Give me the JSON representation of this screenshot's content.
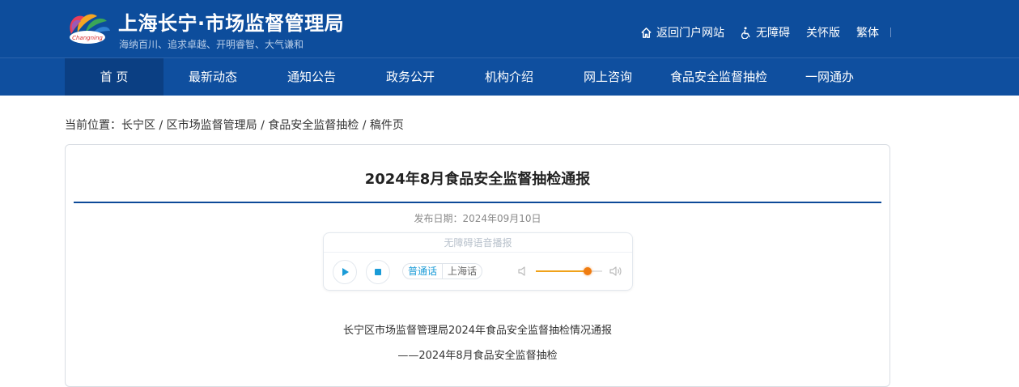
{
  "header": {
    "site_title": "上海长宁·市场监督管理局",
    "slogan": "海纳百川、追求卓越、开明睿智、大气谦和",
    "top_links": [
      {
        "label": "返回门户网站",
        "icon": "home-icon"
      },
      {
        "label": "无障碍",
        "icon": "wheelchair-icon"
      },
      {
        "label": "关怀版",
        "icon": ""
      },
      {
        "label": "繁体",
        "icon": ""
      }
    ]
  },
  "nav": {
    "items": [
      "首 页",
      "最新动态",
      "通知公告",
      "政务公开",
      "机构介绍",
      "网上咨询",
      "食品安全监督抽检",
      "一网通办"
    ],
    "active_index": 0
  },
  "breadcrumb": {
    "prefix": "当前位置：",
    "items": [
      "长宁区",
      "区市场监督管理局",
      "食品安全监督抽检",
      "稿件页"
    ],
    "separators": [
      " / ",
      " / ",
      " / "
    ]
  },
  "article": {
    "title": "2024年8月食品安全监督抽检通报",
    "publish_date": "发布日期：2024年09月10日",
    "body_lines": [
      "长宁区市场监督管理局2024年食品安全监督抽检情况通报",
      "——2024年8月食品安全监督抽检"
    ]
  },
  "player": {
    "header": "无障碍语音播报",
    "languages": [
      "普通话",
      "上海话"
    ],
    "active_language_index": 0,
    "volume": 0.78,
    "play_icon": "play-icon",
    "stop_icon": "stop-icon",
    "accent_color": "#1a9bd7",
    "volume_color": "#f07c10"
  },
  "colors": {
    "brand_blue": "#0d4a98",
    "nav_active": "#0b3f83"
  }
}
